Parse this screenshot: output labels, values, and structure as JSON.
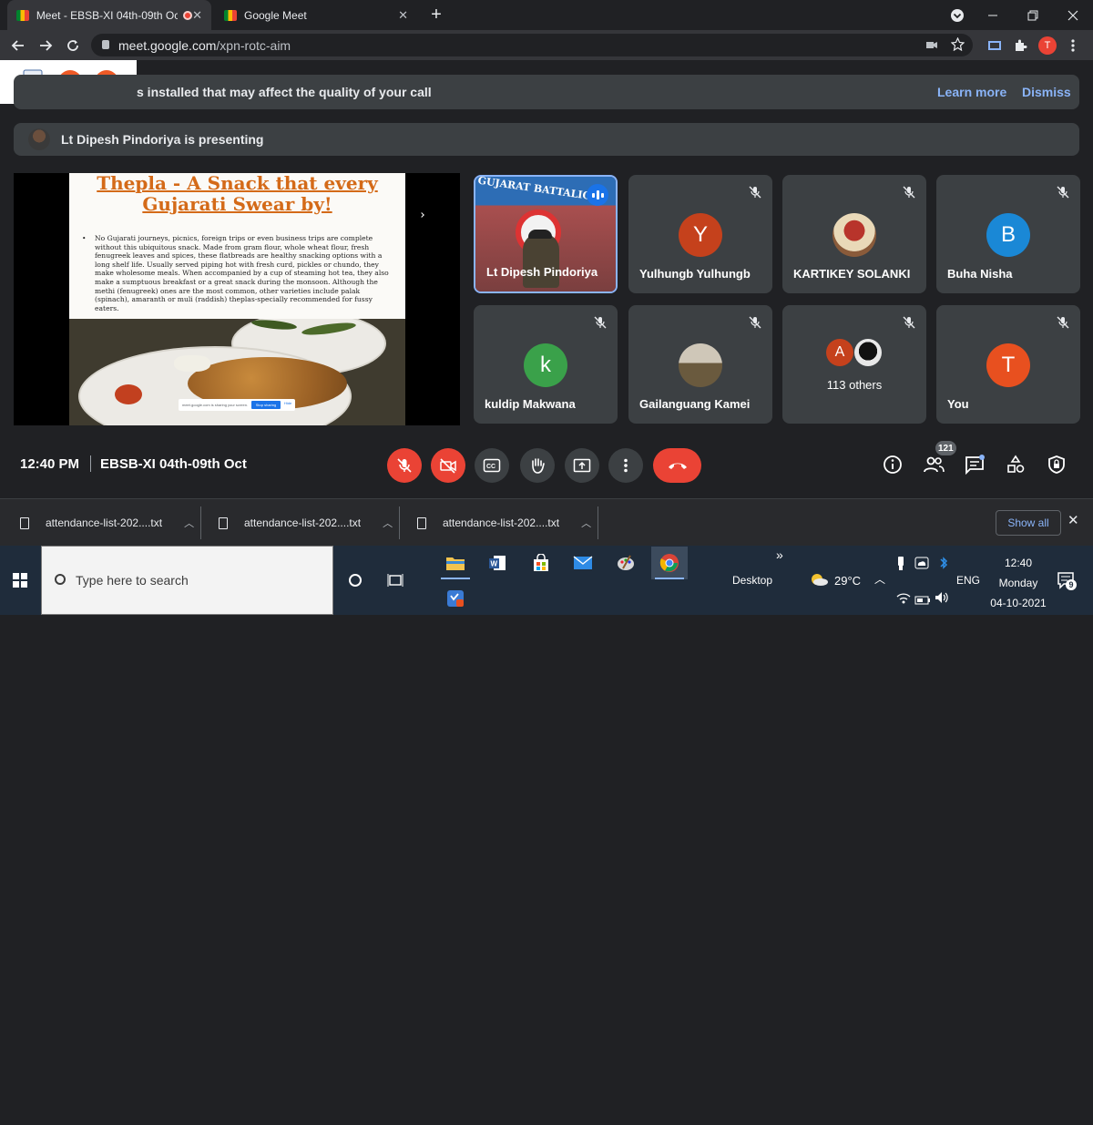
{
  "browser": {
    "tabs": [
      {
        "label": "Meet - EBSB-XI 04th-09th Oc",
        "active": true,
        "recording": true
      },
      {
        "label": "Google Meet",
        "active": false
      }
    ],
    "new_tab": "+",
    "url_domain": "meet.google.com",
    "url_path": "/xpn-rotc-aim",
    "profile_initial": "T"
  },
  "banner": {
    "message": "s installed that may affect the quality of your call",
    "learn_more": "Learn more",
    "dismiss": "Dismiss"
  },
  "presenting": {
    "message": "Lt Dipesh Pindoriya is presenting"
  },
  "slide": {
    "title_line1": "Thepla - A Snack that every",
    "title_line2": "Gujarati Swear by!",
    "bullet": "•",
    "body": "No Gujarati journeys, picnics, foreign trips or even business trips are complete without this ubiquitous snack. Made from gram flour, whole wheat flour, fresh fenugreek leaves and spices, these flatbreads are healthy snacking options with a long shelf life. Usually served piping hot with fresh curd, pickles or chundo, they make wholesome meals. When accompanied by a cup of steaming hot tea, they also make a sumptuous breakfast or a great snack during the monsoon. Although the methi (fenugreek) ones are the most common, other varieties include palak (spinach), amaranth or muli (raddish) theplas-specially recommended for fussy eaters.",
    "share_text": "meet.google.com is sharing your screen.",
    "stop_sharing": "Stop sharing",
    "hide": "Hide"
  },
  "participants": [
    {
      "name": "Lt Dipesh Pindoriya",
      "type": "video",
      "banner_text": "GUJARAT BATTALION",
      "speaking": true
    },
    {
      "name": "Yulhungb Yulhungb",
      "initial": "Y",
      "color": "#c5411c",
      "muted": true
    },
    {
      "name": "KARTIKEY SOLANKI",
      "type": "photo",
      "muted": true
    },
    {
      "name": "Buha Nisha",
      "initial": "B",
      "color": "#1a88d6",
      "muted": true
    },
    {
      "name": "kuldip Makwana",
      "initial": "k",
      "color": "#3aa14a",
      "muted": true
    },
    {
      "name": "Gailanguang Kamei",
      "type": "photo",
      "muted": true
    },
    {
      "name": "113 others",
      "initial": "A",
      "color": "#c5411c",
      "muted": true
    },
    {
      "name": "You",
      "initial": "T",
      "color": "#e8501f",
      "muted": true
    }
  ],
  "meeting_bar": {
    "time": "12:40 PM",
    "separator": "|",
    "meeting_name": "EBSB-XI 04th-09th Oct",
    "participant_count": "121"
  },
  "downloads": {
    "items": [
      {
        "name": "attendance-list-202....txt"
      },
      {
        "name": "attendance-list-202....txt"
      },
      {
        "name": "attendance-list-202....txt"
      }
    ],
    "show_all": "Show all"
  },
  "taskbar": {
    "search_placeholder": "Type here to search",
    "desktop_label": "Desktop",
    "overflow": "»",
    "weather": "29°C",
    "language": "ENG",
    "time": "12:40",
    "day": "Monday",
    "date": "04-10-2021",
    "notification_count": "9"
  }
}
